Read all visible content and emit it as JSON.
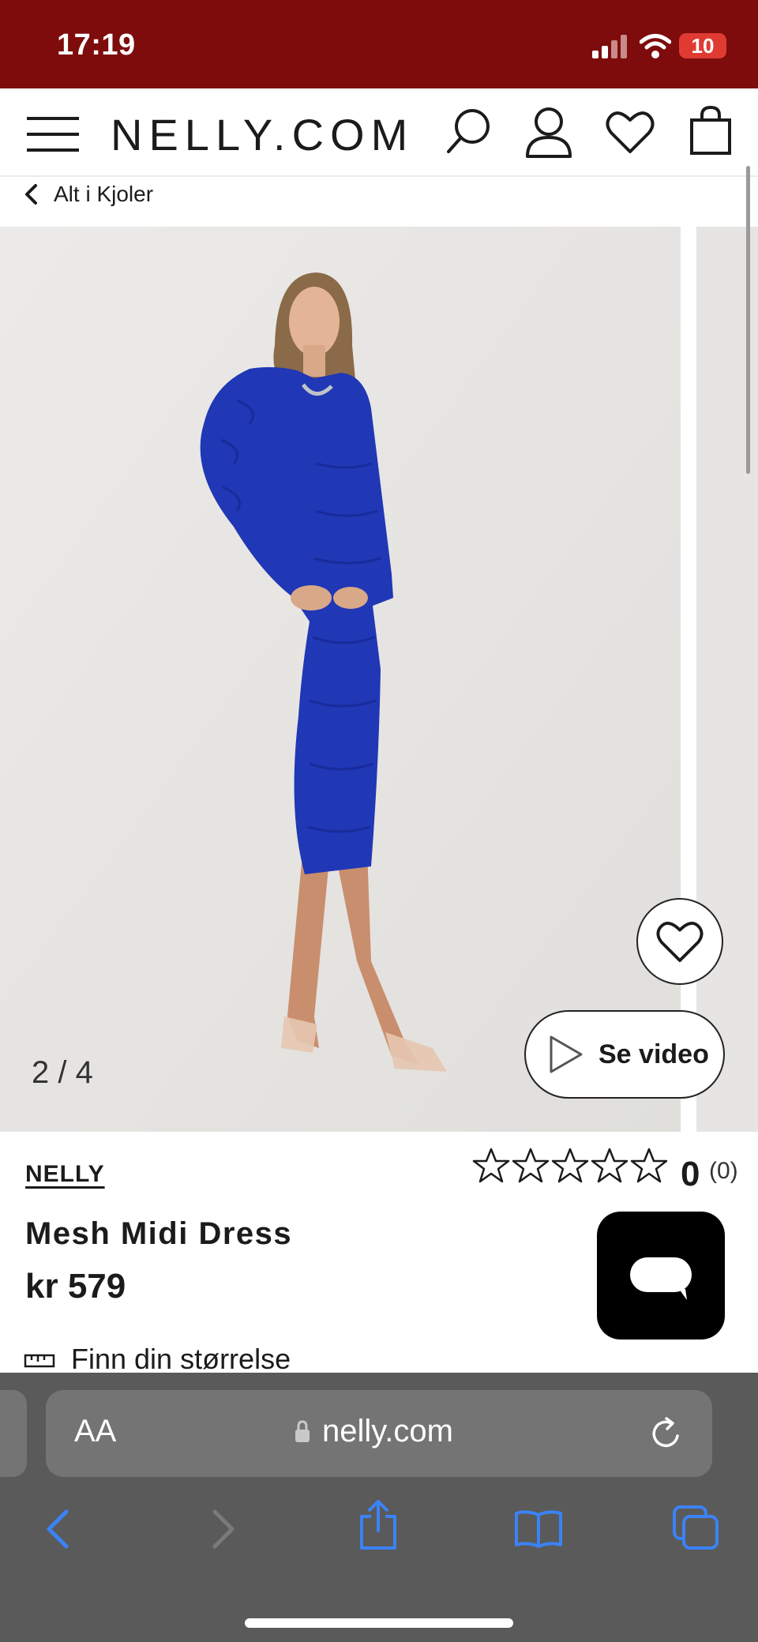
{
  "status": {
    "time": "17:19",
    "battery": "10"
  },
  "header": {
    "logo": "NELLY.COM"
  },
  "breadcrumb": {
    "label": "Alt i Kjoler"
  },
  "gallery": {
    "counter": "2 / 4",
    "video_label": "Se video"
  },
  "product": {
    "brand": "NELLY",
    "name": "Mesh Midi Dress",
    "price": "kr 579",
    "rating_value": "0",
    "rating_count": "(0)",
    "stars_filled": 0,
    "stars_total": 5,
    "size_link": "Finn din størrelse"
  },
  "browser": {
    "aa": "AA",
    "url": "nelly.com"
  },
  "colors": {
    "status_bar": "#7e0c0c",
    "toolbar_accent": "#3b82f6",
    "dress_blue": "#1f36b8"
  }
}
